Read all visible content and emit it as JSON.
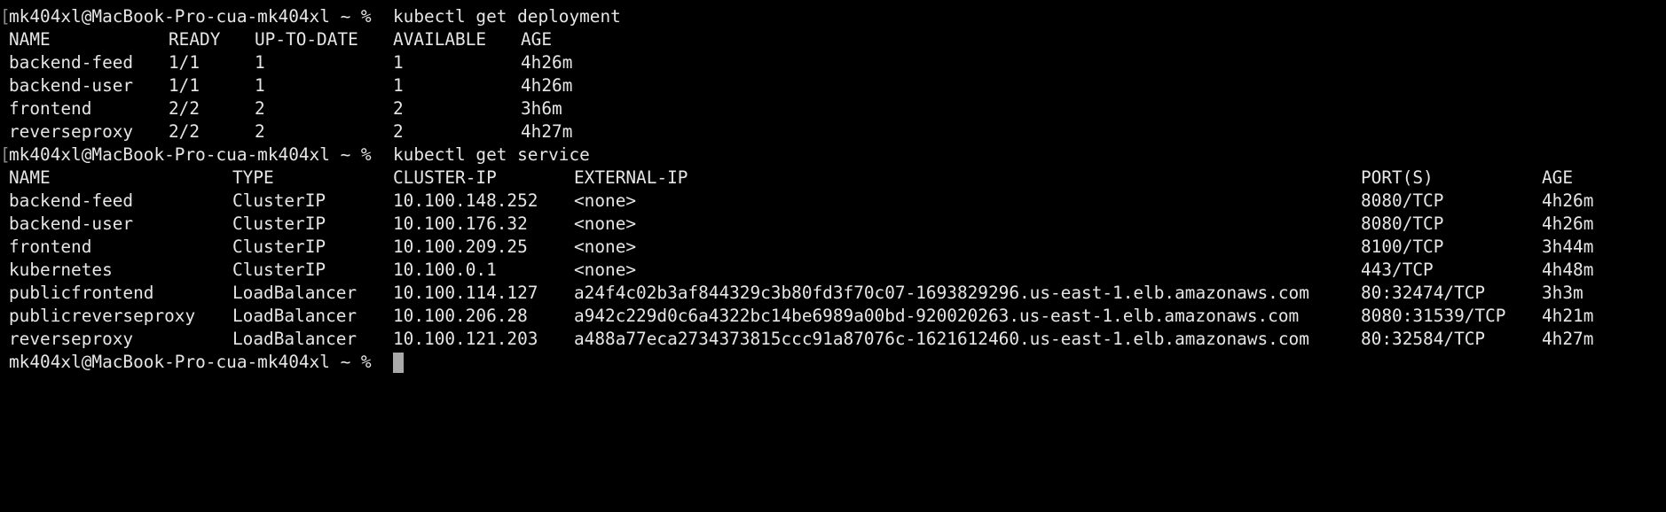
{
  "terminal": {
    "prompt": "mk404xl@MacBook-Pro-cua-mk404xl ~ %",
    "bracket": "[",
    "cmd_deployment": "kubectl get deployment",
    "cmd_service": "kubectl get service",
    "deployment": {
      "headers": [
        "NAME",
        "READY",
        "UP-TO-DATE",
        "AVAILABLE",
        "AGE"
      ],
      "rows": [
        [
          "backend-feed",
          "1/1",
          "1",
          "1",
          "4h26m"
        ],
        [
          "backend-user",
          "1/1",
          "1",
          "1",
          "4h26m"
        ],
        [
          "frontend",
          "2/2",
          "2",
          "2",
          "3h6m"
        ],
        [
          "reverseproxy",
          "2/2",
          "2",
          "2",
          "4h27m"
        ]
      ]
    },
    "service": {
      "headers": [
        "NAME",
        "TYPE",
        "CLUSTER-IP",
        "EXTERNAL-IP",
        "PORT(S)",
        "AGE"
      ],
      "rows": [
        [
          "backend-feed",
          "ClusterIP",
          "10.100.148.252",
          "<none>",
          "8080/TCP",
          "4h26m"
        ],
        [
          "backend-user",
          "ClusterIP",
          "10.100.176.32",
          "<none>",
          "8080/TCP",
          "4h26m"
        ],
        [
          "frontend",
          "ClusterIP",
          "10.100.209.25",
          "<none>",
          "8100/TCP",
          "3h44m"
        ],
        [
          "kubernetes",
          "ClusterIP",
          "10.100.0.1",
          "<none>",
          "443/TCP",
          "4h48m"
        ],
        [
          "publicfrontend",
          "LoadBalancer",
          "10.100.114.127",
          "a24f4c02b3af844329c3b80fd3f70c07-1693829296.us-east-1.elb.amazonaws.com",
          "80:32474/TCP",
          "3h3m"
        ],
        [
          "publicreverseproxy",
          "LoadBalancer",
          "10.100.206.28",
          "a942c229d0c6a4322bc14be6989a00bd-920020263.us-east-1.elb.amazonaws.com",
          "8080:31539/TCP",
          "4h21m"
        ],
        [
          "reverseproxy",
          "LoadBalancer",
          "10.100.121.203",
          "a488a77eca2734373815ccc91a87076c-1621612460.us-east-1.elb.amazonaws.com",
          "80:32584/TCP",
          "4h27m"
        ]
      ]
    }
  }
}
